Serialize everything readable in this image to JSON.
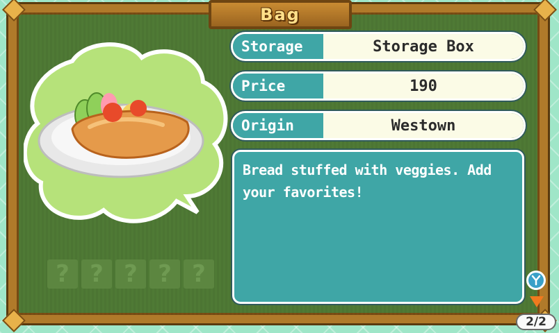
{
  "window": {
    "title": "Bag"
  },
  "item": {
    "fields": [
      {
        "label": "Storage",
        "value": "Storage Box"
      },
      {
        "label": "Price",
        "value": "190"
      },
      {
        "label": "Origin",
        "value": "Westown"
      }
    ],
    "description": "Bread stuffed with veggies. Add your favorites!",
    "image_icon": "stuffed-bread-icon"
  },
  "quality_slots": [
    "?",
    "?",
    "?",
    "?",
    "?"
  ],
  "controls": {
    "y_button_icon": "y-button-icon",
    "next_icon": "down-arrow-icon"
  },
  "pager": {
    "text": "2/2"
  },
  "colors": {
    "frame": "#b07a2a",
    "board": "#4f7a35",
    "teal": "#3fa6a6",
    "cream": "#fbfbe6",
    "title_text": "#ffe08a"
  }
}
